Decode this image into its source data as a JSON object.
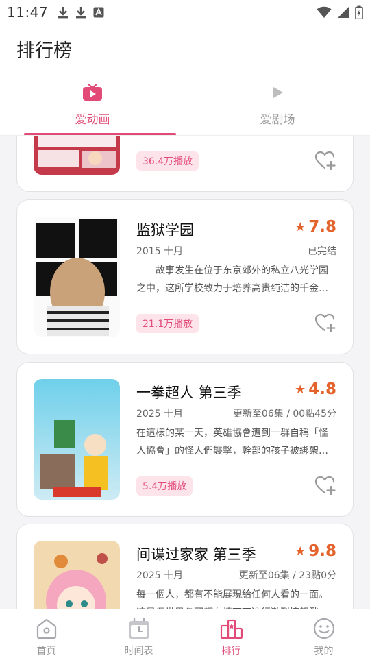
{
  "status_bar": {
    "time": "11:47"
  },
  "header": {
    "title": "排行榜"
  },
  "tabs": [
    {
      "label": "爱动画",
      "active": true
    },
    {
      "label": "爱剧场",
      "active": false
    }
  ],
  "cards": [
    {
      "plays": "36.4万播放"
    },
    {
      "title": "监狱学园",
      "score": "7.8",
      "year": "2015 十月",
      "status": "已完结",
      "desc": "　　故事发生在位于东京郊外的私立八光学园之中，这所学校致力于培养高贵纯洁的千金小姐，是男性禁止入内的女子学校。",
      "plays": "21.1万播放"
    },
    {
      "title": "一拳超人 第三季",
      "score": "4.8",
      "year": "2025 十月",
      "status": "更新至06集 / 00點45分",
      "desc": "在這樣的某一天，英雄協會遭到一群自稱「怪人協會」的怪人們襲擊，幹部的孩子被綁架了。",
      "plays": "5.4万播放"
    },
    {
      "title": "间谍过家家 第三季",
      "score": "9.8",
      "year": "2025 十月",
      "status": "更新至06集 / 23點0分",
      "desc": "每一個人，都有不能展現給任何人看的一面。這是個世界各國都在檯面下進行激烈情報戰的時代。",
      "plays": ""
    }
  ],
  "bottom_nav": [
    {
      "label": "首页",
      "icon": "home-icon",
      "active": false
    },
    {
      "label": "时间表",
      "icon": "calendar-icon",
      "active": false
    },
    {
      "label": "排行",
      "icon": "ranking-icon",
      "active": true
    },
    {
      "label": "我的",
      "icon": "profile-icon",
      "active": false
    }
  ],
  "colors": {
    "accent": "#e24a78",
    "score": "#e4632c",
    "badge_bg": "#fde4ea"
  }
}
